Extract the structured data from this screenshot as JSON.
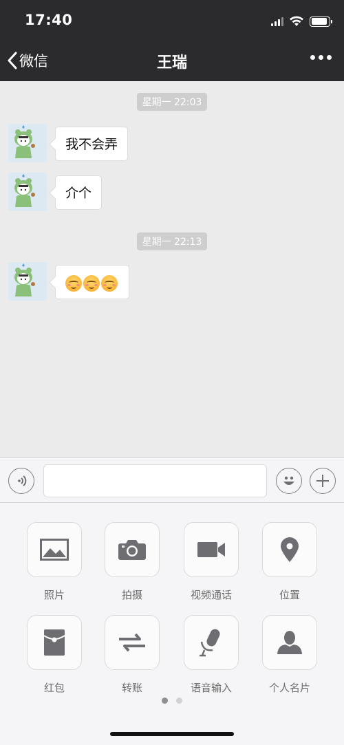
{
  "status_bar": {
    "time": "17:40",
    "battery_level": 0.9
  },
  "nav": {
    "back_label": "微信",
    "title": "王瑞"
  },
  "chat": {
    "groups": [
      {
        "timestamp": "星期一 22:03"
      },
      {
        "timestamp": "星期一 22:13"
      }
    ],
    "messages": [
      {
        "text": "我不会弄"
      },
      {
        "text": "介个"
      },
      {
        "text": "",
        "emoji": [
          "flushed-smile",
          "flushed-smile",
          "flushed-smile"
        ]
      }
    ]
  },
  "panel": {
    "items": [
      {
        "label": "照片",
        "icon": "photo-icon"
      },
      {
        "label": "拍摄",
        "icon": "camera-icon"
      },
      {
        "label": "视频通话",
        "icon": "video-call-icon"
      },
      {
        "label": "位置",
        "icon": "location-icon"
      },
      {
        "label": "红包",
        "icon": "red-packet-icon"
      },
      {
        "label": "转账",
        "icon": "transfer-icon"
      },
      {
        "label": "语音输入",
        "icon": "microphone-icon"
      },
      {
        "label": "个人名片",
        "icon": "contact-card-icon"
      }
    ],
    "page_count": 2,
    "current_page": 1
  },
  "colors": {
    "nav_bg": "#2b2b2d",
    "chat_bg": "#ebebeb",
    "panel_bg": "#f5f5f7",
    "icon_gray": "#6e6e72"
  }
}
